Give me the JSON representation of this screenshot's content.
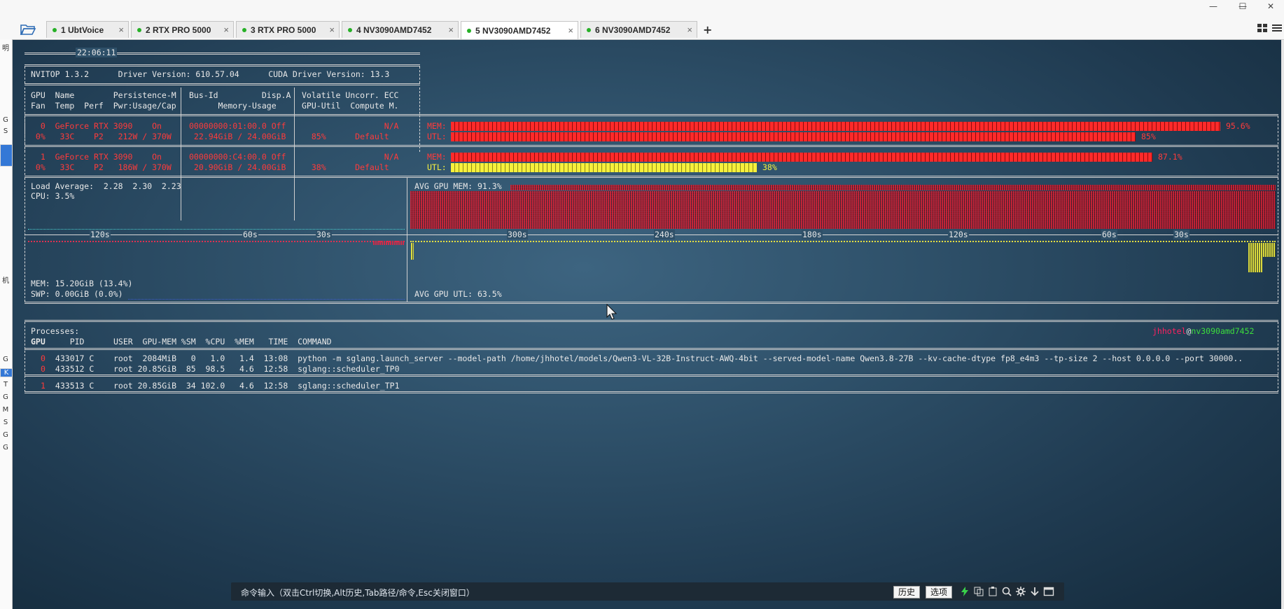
{
  "window": {
    "minimize_glyph": "—",
    "maximize_glyph": "☐",
    "close_glyph": "✕"
  },
  "tabs": [
    {
      "label": "1 UbtVoice",
      "close": "×",
      "active": false
    },
    {
      "label": "2 RTX PRO 5000",
      "close": "×",
      "active": false
    },
    {
      "label": "3 RTX PRO 5000",
      "close": "×",
      "active": false
    },
    {
      "label": "4 NV3090AMD7452",
      "close": "×",
      "active": false
    },
    {
      "label": "5 NV3090AMD7452",
      "close": "×",
      "active": true
    },
    {
      "label": "6 NV3090AMD7452",
      "close": "×",
      "active": false
    }
  ],
  "add_tab": "+",
  "left_strip": [
    "明",
    "G",
    "S",
    "机",
    "G",
    "K",
    "T",
    "G",
    "M",
    "S",
    "G",
    "G"
  ],
  "terminal": {
    "clock": "22:06:11",
    "header_line": "NVITOP 1.3.2      Driver Version: 610.57.04      CUDA Driver Version: 13.3",
    "col_head_1a": "GPU  Name        Persistence-M",
    "col_head_1b": "Bus-Id         Disp.A",
    "col_head_1c": "Volatile Uncorr. ECC",
    "col_head_2a": "Fan  Temp  Perf  Pwr:Usage/Cap",
    "col_head_2b": "      Memory-Usage",
    "col_head_2c": "GPU-Util  Compute M.",
    "gpus": [
      {
        "row1a": "  0  GeForce RTX 3090    On",
        "row1b": "00000000:01:00.0 Off",
        "row1c": "                 N/A",
        "row2a": " 0%   33C    P2   212W / 370W",
        "row2b": " 22.94GiB / 24.00GiB",
        "row2c": "  85%      Default",
        "mem_label": "MEM:",
        "mem_pct_text": "95.6%",
        "mem_frac": 0.956,
        "utl_label": "UTL:",
        "utl_pct_text": "85%",
        "utl_frac": 0.85,
        "utl_color": "red"
      },
      {
        "row1a": "  1  GeForce RTX 3090    On",
        "row1b": "00000000:C4:00.0 Off",
        "row1c": "                 N/A",
        "row2a": " 0%   33C    P2   186W / 370W",
        "row2b": " 20.90GiB / 24.00GiB",
        "row2c": "  38%      Default",
        "mem_label": "MEM:",
        "mem_pct_text": "87.1%",
        "mem_frac": 0.871,
        "utl_label": "UTL:",
        "utl_pct_text": "38%",
        "utl_frac": 0.38,
        "utl_color": "yellow"
      }
    ],
    "load_average": "Load Average:  2.28  2.30  2.23",
    "cpu": "CPU: 3.5%",
    "avg_gpu_mem": "AVG GPU MEM: 91.3%",
    "left_ticks": [
      "120s",
      "60s",
      "30s"
    ],
    "right_ticks": [
      "300s",
      "240s",
      "180s",
      "120s",
      "60s",
      "30s"
    ],
    "mem": "MEM: 15.20GiB (13.4%)",
    "swp": "SWP: 0.00GiB (0.0%)",
    "avg_gpu_utl": "AVG GPU UTL: 63.5%",
    "processes_title": "Processes:",
    "user": "jhhotel",
    "at": "@",
    "host": "nv3090amd7452",
    "proc_head": {
      "gpu": "GPU",
      "rest": "    PID      USER  GPU-MEM %SM  %CPU  %MEM   TIME  COMMAND"
    },
    "procs": [
      {
        "gpu": "0",
        "rest": " 433017 C    root  2084MiB   0   1.0   1.4  13:08  python -m sglang.launch_server --model-path /home/jhhotel/models/Qwen3-VL-32B-Instruct-AWQ-4bit --served-model-name Qwen3.8-27B --kv-cache-dtype fp8_e4m3 --tp-size 2 --host 0.0.0.0 --port 30000.."
      },
      {
        "gpu": "0",
        "rest": " 433512 C    root 20.85GiB  85  98.5   4.6  12:58  sglang::scheduler_TP0"
      },
      {
        "gpu": "1",
        "rest": " 433513 C    root 20.85GiB  34 102.0   4.6  12:58  sglang::scheduler_TP1"
      }
    ]
  },
  "command_bar": {
    "hint": "命令输入（双击Ctrl切换,Alt历史,Tab路径/命令,Esc关闭窗口）",
    "history_btn": "历史",
    "options_btn": "选项"
  }
}
